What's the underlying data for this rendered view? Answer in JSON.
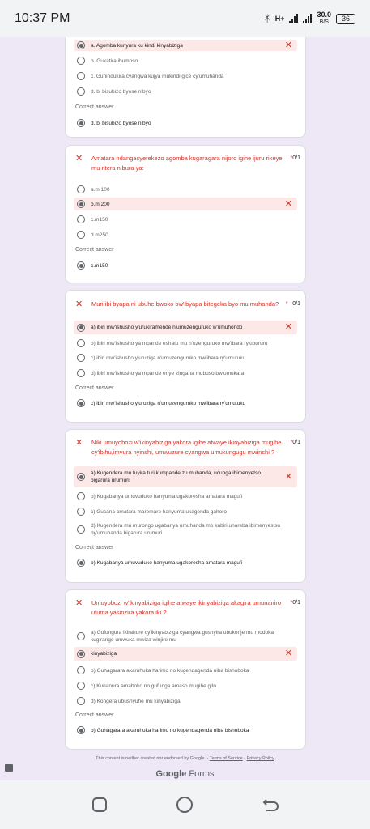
{
  "status": {
    "time": "10:37 PM",
    "net_top": "H+",
    "speed": "30.0",
    "speed_unit": "B/S",
    "battery": "36"
  },
  "cards": [
    {
      "options": [
        "a. Agomba kunyura ku kindi kinyabiziga",
        "b. Gukatira ibumoso",
        "c. Guhindukira cyangwa kujya mukindi gice cy'umuhanda",
        "d.Ibi bisubizo byose nibyo"
      ],
      "correct_label": "Correct answer",
      "correct": "d.Ibi bisubizo byose nibyo"
    },
    {
      "title": "Amatara ndangacyerekezo agomba kugaragara nijoro igihe ijuru rikeye mu ntera nibura ya:",
      "points": "0/1",
      "options": [
        "a.m 100",
        "b.m 200",
        "c.m150",
        "d.m250"
      ],
      "correct_label": "Correct answer",
      "correct": "c.m150"
    },
    {
      "title": "Muri ibi byapa ni ubuhe bwoko bw'ibyapa bitegeka byo mu muhanda?",
      "points": "0/1",
      "options": [
        "a) ibiri mw'ishusho y'urukiramende n'umuzenguruko w'umuhondo",
        "b) ibiri mw'ishusho ya mpande eshatu mu n'uzenguruko mw'ibara ry'ubururu",
        "c) ibiri mw'ishusho y'uruziga n'umuzenguruko mw'ibara ry'umutuku",
        "d) ibiri mw'ishusho ya mpande enye zingana mubuso bw'umukara"
      ],
      "correct_label": "Correct answer",
      "correct": "c) ibiri mw'ishusho y'uruziga n'umuzenguruko mw'ibara ry'umutuku"
    },
    {
      "title": "Niki umuyobozi w'ikinyabiziga yakora igihe atwaye ikinyabiziga mugihe cy'ibihu,imvura nyinshi, umwuzure cyangwa umukungugu mwinshi ?",
      "points": "0/1",
      "options": [
        "a) Kugendera mu tuyira turi kumpande zu muhanda, ucunga ibimenyetso bigarura urumuri",
        "b) Kugabanya umuvuduko hanyuma ugakoresha amatara magufi",
        "c) Gucana amatara maremare hanyuma ukagenda gahoro",
        "d) Kugendera mu murongo ugabanya umuhanda mo kabiri unareba ibimenyestso by'umuhanda bigarura urumuri"
      ],
      "correct_label": "Correct answer",
      "correct": "b) Kugabanya umuvuduko hanyuma ugakoresha amatara magufi"
    },
    {
      "title": "Umuyobozi w'ikinyabiziga igihe atwaye ikinyabiziga akagira umunaniro utuma yasinzira yakora iki ?",
      "points": "0/1",
      "options": [
        "a) Gufungura ikirahure cy'ikinyabiziga cyangwa gushyira ubukonje mu modoka kugirango umwuka mwiza winjire mu",
        "kinyabiziga",
        "b) Guhagarara akaruhuka harimo no kugendagenda niba bishoboka",
        "c) Kunanura amaboko no gufunga amaso mugihe gito",
        "d) Kongera ubushyuhe mu kinyabiziga"
      ],
      "correct_label": "Correct answer",
      "correct": "b) Guhagarara akaruhuka harimo no kugendagenda niba bishoboka"
    }
  ],
  "footer": {
    "note": "This content is neither created nor endorsed by Google. -",
    "terms": "Terms of Service",
    "sep": " - ",
    "privacy": "Privacy Policy",
    "brand_google": "Google",
    "brand_forms": "Forms"
  },
  "colors": {
    "error": "#d93025",
    "selected_bg": "#fce8e6",
    "page_bg": "#ede7f6"
  }
}
